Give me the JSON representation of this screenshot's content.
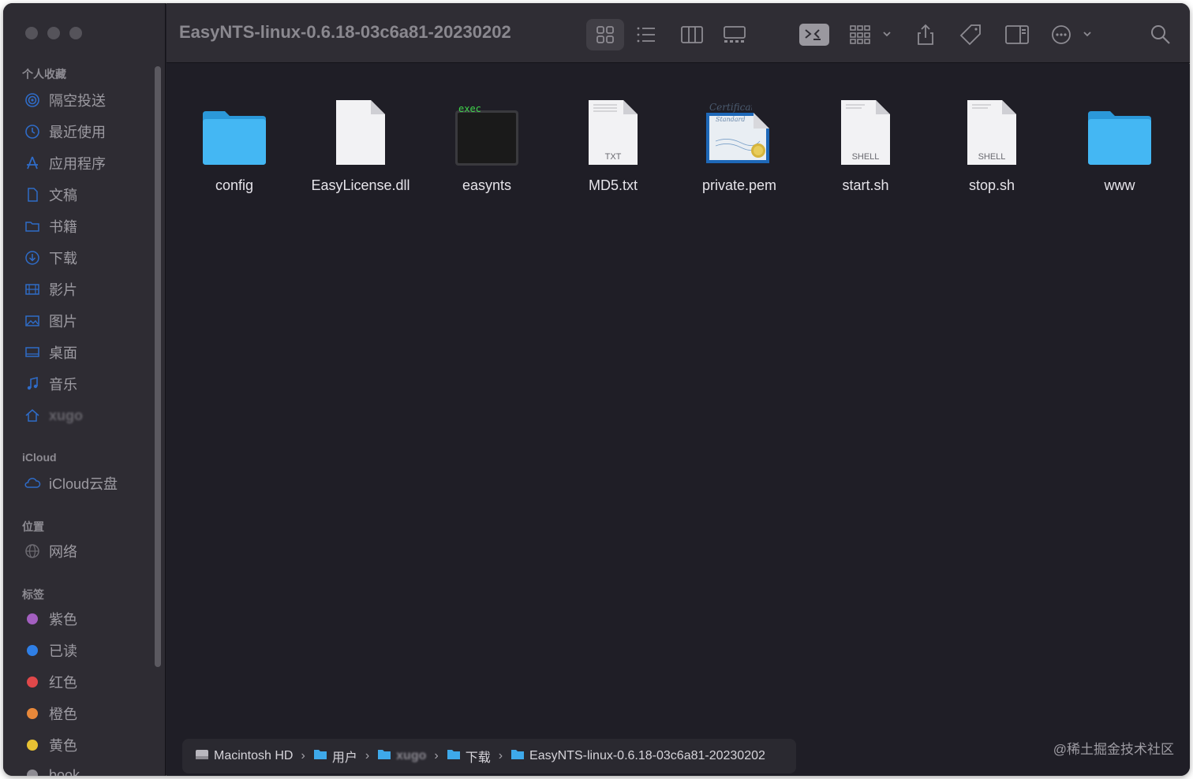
{
  "window": {
    "title": "EasyNTS-linux-0.6.18-03c6a81-20230202"
  },
  "sidebar": {
    "sections": [
      {
        "heading": "个人收藏",
        "items": [
          {
            "label": "隔空投送",
            "icon": "airdrop-icon"
          },
          {
            "label": "最近使用",
            "icon": "clock-icon"
          },
          {
            "label": "应用程序",
            "icon": "applications-icon"
          },
          {
            "label": "文稿",
            "icon": "document-icon"
          },
          {
            "label": "书籍",
            "icon": "folder-icon"
          },
          {
            "label": "下载",
            "icon": "download-icon"
          },
          {
            "label": "影片",
            "icon": "film-icon"
          },
          {
            "label": "图片",
            "icon": "photo-icon"
          },
          {
            "label": "桌面",
            "icon": "desktop-icon"
          },
          {
            "label": "音乐",
            "icon": "music-icon"
          },
          {
            "label": "xugo",
            "icon": "home-icon",
            "blurred": true
          }
        ]
      },
      {
        "heading": "iCloud",
        "items": [
          {
            "label": "iCloud云盘",
            "icon": "cloud-icon"
          }
        ]
      },
      {
        "heading": "位置",
        "items": [
          {
            "label": "网络",
            "icon": "network-icon"
          }
        ]
      },
      {
        "heading": "标签",
        "items": [
          {
            "label": "紫色",
            "color": "#a35fc0"
          },
          {
            "label": "已读",
            "color": "#2f7fe6"
          },
          {
            "label": "红色",
            "color": "#e0484a"
          },
          {
            "label": "橙色",
            "color": "#e8883a"
          },
          {
            "label": "黄色",
            "color": "#e8c233"
          },
          {
            "label": "book",
            "color": "#8e8c93",
            "partial": true
          }
        ]
      }
    ]
  },
  "toolbar": {
    "buttons": [
      "icon-view-icon",
      "list-view-icon",
      "column-view-icon",
      "gallery-view-icon",
      "terminal-icon",
      "group-icon",
      "share-icon",
      "tag-icon",
      "preview-pane-icon",
      "more-icon",
      "search-icon"
    ]
  },
  "files": [
    {
      "name": "config",
      "kind": "folder"
    },
    {
      "name": "EasyLicense.dll",
      "kind": "document"
    },
    {
      "name": "easynts",
      "kind": "exec",
      "badge": "exec"
    },
    {
      "name": "MD5.txt",
      "kind": "text",
      "badge": "TXT"
    },
    {
      "name": "private.pem",
      "kind": "certificate",
      "badge": "Certificate",
      "sub": "Standard"
    },
    {
      "name": "start.sh",
      "kind": "shell",
      "badge": "SHELL"
    },
    {
      "name": "stop.sh",
      "kind": "shell",
      "badge": "SHELL"
    },
    {
      "name": "www",
      "kind": "folder"
    }
  ],
  "pathbar": [
    {
      "label": "Macintosh HD",
      "icon": "disk-icon"
    },
    {
      "label": "用户",
      "icon": "folder-icon"
    },
    {
      "label": "xugo",
      "icon": "folder-icon",
      "blurred": true
    },
    {
      "label": "下载",
      "icon": "folder-icon"
    },
    {
      "label": "EasyNTS-linux-0.6.18-03c6a81-20230202",
      "icon": "folder-icon"
    }
  ],
  "watermark": "@稀土掘金技术社区",
  "colors": {
    "folder": "#3cb2f2",
    "accent": "#2f7fe6",
    "background": "#1f1e26"
  }
}
